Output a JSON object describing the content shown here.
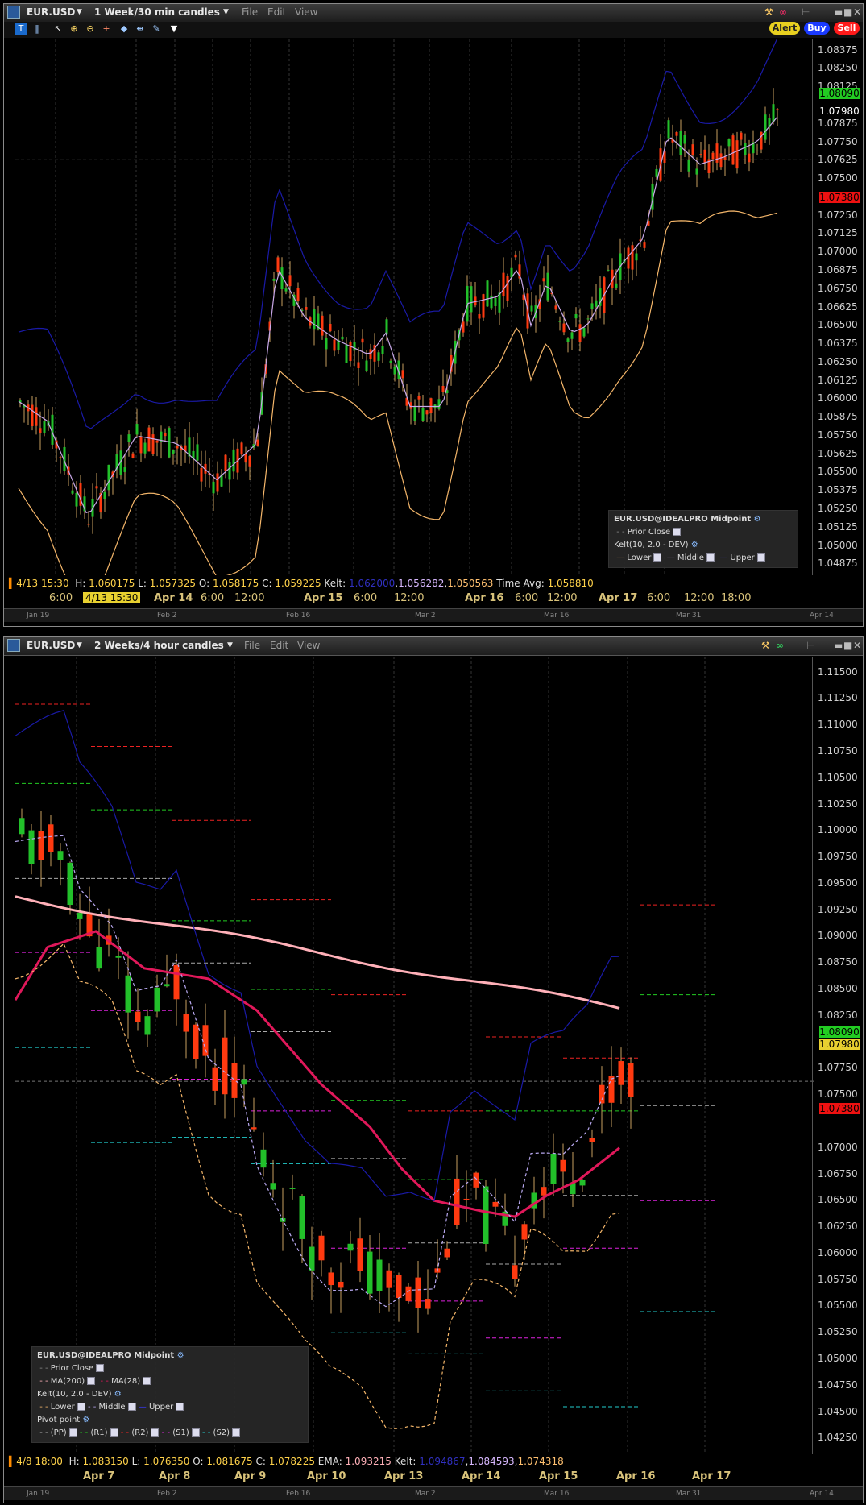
{
  "top": {
    "symbol": "EUR.USD",
    "timeframe": "1 Week/30 min candles",
    "menus": [
      "File",
      "Edit",
      "View"
    ],
    "buttons": {
      "alert": "Alert",
      "buy": "Buy",
      "sell": "Sell"
    },
    "price_axis": [
      "1.08375",
      "1.08250",
      "1.08125",
      "1.07875",
      "1.07750",
      "1.07625",
      "1.07500",
      "1.07250",
      "1.07125",
      "1.07000",
      "1.06875",
      "1.06750",
      "1.06625",
      "1.06500",
      "1.06375",
      "1.06250",
      "1.06125",
      "1.06000",
      "1.05875",
      "1.05750",
      "1.05625",
      "1.05500",
      "1.05375",
      "1.05250",
      "1.05125",
      "1.05000",
      "1.04875"
    ],
    "price_tags": {
      "bid": "1.08090",
      "last": "1.07980",
      "ask": "1.07380"
    },
    "info": {
      "time": "4/13 15:30",
      "h_label": "H:",
      "h": "1.060175",
      "l_label": "L:",
      "l": "1.057325",
      "o_label": "O:",
      "o": "1.058175",
      "c_label": "C:",
      "c": "1.059225",
      "kelt_label": "Kelt:",
      "kelt_upper": "1.062000",
      "kelt_middle": "1.056282",
      "kelt_lower": "1.050563",
      "tavg_label": "Time Avg:",
      "tavg": "1.058810"
    },
    "x_labels": [
      "6:00",
      "12:00",
      "Apr 14",
      "6:00",
      "12:00",
      "Apr 15",
      "6:00",
      "12:00",
      "Apr 16",
      "6:00",
      "12:00",
      "Apr 17",
      "6:00",
      "12:00",
      "18:00"
    ],
    "cursor_time": "4/13 15:30",
    "mini_labels": [
      "Jan 19",
      "Feb 2",
      "Feb 16",
      "Mar 2",
      "Mar 16",
      "Mar 31",
      "Apr 14"
    ],
    "legend": {
      "title": "EUR.USD@IDEALPRO Midpoint",
      "prior_close": "Prior Close",
      "kelt": "Kelt(10, 2.0 - DEV)",
      "lower": "Lower",
      "middle": "Middle",
      "upper": "Upper"
    },
    "colors": {
      "up": "#22c02a",
      "down": "#ff3a10",
      "upper": "#1a1aa8",
      "middle": "#c9a8e8",
      "lower": "#f4b66a"
    }
  },
  "bottom": {
    "symbol": "EUR.USD",
    "timeframe": "2 Weeks/4 hour candles",
    "menus": [
      "File",
      "Edit",
      "View"
    ],
    "price_axis": [
      "1.11500",
      "1.11250",
      "1.11000",
      "1.10750",
      "1.10500",
      "1.10250",
      "1.10000",
      "1.09750",
      "1.09500",
      "1.09250",
      "1.09000",
      "1.08750",
      "1.08500",
      "1.08250",
      "1.07750",
      "1.07500",
      "1.07000",
      "1.06750",
      "1.06500",
      "1.06250",
      "1.06000",
      "1.05750",
      "1.05500",
      "1.05250",
      "1.05000",
      "1.04750",
      "1.04500",
      "1.04250"
    ],
    "price_tags": {
      "bid": "1.08090",
      "last": "1.07980",
      "ask": "1.07380"
    },
    "info": {
      "time": "4/8 18:00",
      "h_label": "H:",
      "h": "1.083150",
      "l_label": "L:",
      "l": "1.076350",
      "o_label": "O:",
      "o": "1.081675",
      "c_label": "C:",
      "c": "1.078225",
      "ema_label": "EMA:",
      "ema": "1.093215",
      "kelt_label": "Kelt:",
      "kelt_upper": "1.094867",
      "kelt_middle": "1.084593",
      "kelt_lower": "1.074318"
    },
    "x_labels": [
      "Apr 7",
      "Apr 8",
      "Apr 9",
      "Apr 10",
      "Apr 13",
      "Apr 14",
      "Apr 15",
      "Apr 16",
      "Apr 17"
    ],
    "mini_labels": [
      "Jan 19",
      "Feb 2",
      "Feb 16",
      "Mar 2",
      "Mar 16",
      "Mar 31",
      "Apr 14"
    ],
    "legend": {
      "title": "EUR.USD@IDEALPRO Midpoint",
      "prior_close": "Prior Close",
      "ma200": "MA(200)",
      "ma28": "MA(28)",
      "kelt": "Kelt(10, 2.0 - DEV)",
      "lower": "Lower",
      "middle": "Middle",
      "upper": "Upper",
      "pivot": "Pivot point",
      "pp": "(PP)",
      "r1": "(R1)",
      "r2": "(R2)",
      "s1": "(S1)",
      "s2": "(S2)"
    },
    "colors": {
      "up": "#22c02a",
      "down": "#ff3a10",
      "ma200": "#ffb0b8",
      "ma28": "#e0185a",
      "upper": "#1a1aa8",
      "middle": "#b8a8f0",
      "lower": "#f4b66a"
    }
  }
}
